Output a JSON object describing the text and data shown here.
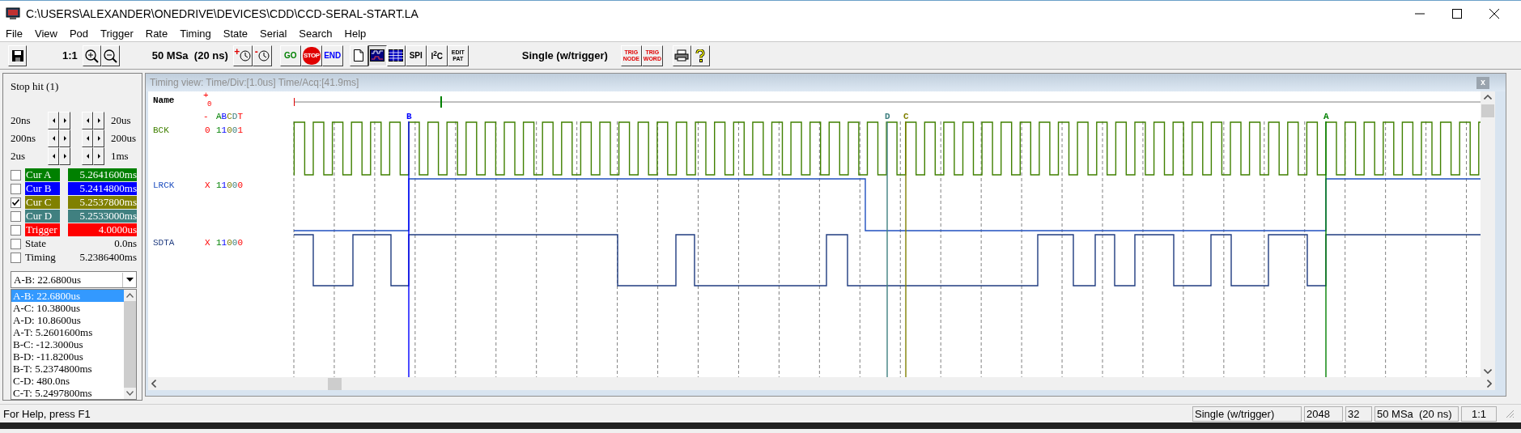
{
  "window": {
    "title": "C:\\USERS\\ALEXANDER\\ONEDRIVE\\DEVICES\\CDD\\CCD-SERAL-START.LA"
  },
  "menu": [
    "File",
    "View",
    "Pod",
    "Trigger",
    "Rate",
    "Timing",
    "State",
    "Serial",
    "Search",
    "Help"
  ],
  "toolbar": [
    [
      {
        "kind": "save"
      }
    ],
    [
      {
        "kind": "label",
        "text": "1:1"
      },
      {
        "kind": "zoom_in"
      },
      {
        "kind": "zoom_out"
      }
    ],
    [
      {
        "kind": "label",
        "text": "50 MSa  (20 ns)"
      },
      {
        "kind": "clock",
        "text": "+"
      },
      {
        "kind": "clock",
        "text": "-"
      }
    ],
    [
      {
        "kind": "text_button",
        "text": "GO",
        "color": "#008000"
      },
      {
        "kind": "stop",
        "text": "STOP"
      },
      {
        "kind": "text_button",
        "text": "END",
        "color": "#0000ff"
      }
    ],
    [
      {
        "kind": "page",
        "selected": false
      },
      {
        "kind": "timing",
        "selected": true
      },
      {
        "kind": "list",
        "selected": false
      },
      {
        "kind": "text_button",
        "text": "SPI",
        "color": "#000000"
      },
      {
        "kind": "text_button",
        "text": "I$^{2}$C",
        "color": "#000000"
      },
      {
        "kind": "two_line",
        "text": "EDIT",
        "text2": "PAT",
        "color": "#000000"
      }
    ],
    [
      {
        "kind": "label",
        "text": "Single (w/trigger)"
      }
    ],
    [
      {
        "kind": "two_line",
        "text": "TRIG",
        "text2": "NODE",
        "color": "#e00000"
      },
      {
        "kind": "two_line",
        "text": "TRIG",
        "text2": "WORD",
        "color": "#e00000"
      }
    ],
    [
      {
        "kind": "print"
      },
      {
        "kind": "help"
      }
    ]
  ],
  "side_panel": {
    "status": "Stop hit (1)",
    "steps": [
      {
        "left": "20ns",
        "right": "20us"
      },
      {
        "left": "200ns",
        "right": "200us"
      },
      {
        "left": "2us",
        "right": "1ms"
      }
    ],
    "cursors": [
      {
        "kind": "cursor",
        "label": "Cur A",
        "value": "5.2641600ms",
        "color": "#008000",
        "checked": false
      },
      {
        "kind": "cursor",
        "label": "Cur B",
        "value": "5.2414800ms",
        "color": "#0000ff",
        "checked": false
      },
      {
        "kind": "cursor",
        "label": "Cur C",
        "value": "5.2537800ms",
        "color": "#808000",
        "checked": true
      },
      {
        "kind": "cursor",
        "label": "Cur D",
        "value": "5.2533000ms",
        "color": "#408080",
        "checked": false
      },
      {
        "kind": "cursor",
        "label": "Trigger",
        "value": "4.0000us",
        "color": "#ff0000",
        "checked": false
      },
      {
        "kind": "plain",
        "label": "State",
        "value": "0.0ns",
        "checked": false
      },
      {
        "kind": "plain",
        "label": "Timing",
        "value": "5.2386400ms",
        "checked": false
      }
    ],
    "dropdown": {
      "value": "A-B: 22.6800us"
    },
    "deltas": [
      {
        "text": "A-B: 22.6800us",
        "selected": true
      },
      {
        "text": "A-C: 10.3800us",
        "selected": false
      },
      {
        "text": "A-D: 10.8600us",
        "selected": false
      },
      {
        "text": "A-T: 5.2601600ms",
        "selected": false
      },
      {
        "text": "B-C: -12.3000us",
        "selected": false
      },
      {
        "text": "B-D: -11.8200us",
        "selected": false
      },
      {
        "text": "B-T: 5.2374800ms",
        "selected": false
      },
      {
        "text": "C-D: 480.0ns",
        "selected": false
      },
      {
        "text": "C-T: 5.2497800ms",
        "selected": false
      }
    ]
  },
  "timing_view": {
    "title": "Timing view:  Time/Div:[1.0us] Time/Acq:[41.9ms]",
    "close": "x",
    "name_header": "Name",
    "plus": "+",
    "zero": "0",
    "minus": "-",
    "column_header": "ABCDT",
    "signals": [
      {
        "kind": "clock",
        "name": "BCK",
        "color": "#408000",
        "state": "0",
        "values": "11001"
      },
      {
        "kind": "frame",
        "name": "LRCK",
        "color": "#2050c0",
        "state": "X",
        "values": "11000"
      },
      {
        "kind": "data",
        "name": "SDTA",
        "color": "#203c80",
        "state": "X",
        "values": "11000"
      }
    ],
    "markers": [
      {
        "label": "B",
        "color": "#0000ff"
      },
      {
        "label": "D",
        "color": "#408080"
      },
      {
        "label": "C",
        "color": "#808000"
      },
      {
        "label": "A",
        "color": "#008000"
      }
    ]
  },
  "status_bar": {
    "help": "For Help, press F1",
    "panes": [
      "Single (w/trigger)",
      "2048",
      "32",
      "50 MSa  (20 ns)",
      "1:1"
    ]
  }
}
